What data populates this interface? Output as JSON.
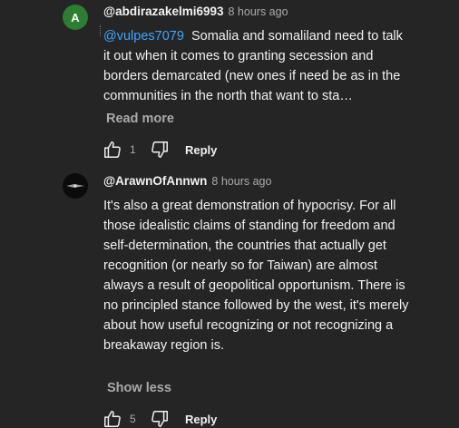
{
  "comments": [
    {
      "avatar_initial": "A",
      "avatar_color": "#2e7d32",
      "author": "@abdirazakelmi6993",
      "time": "8 hours ago",
      "mention": "@vulpes7079",
      "text": "Somalia and somaliland need to talk it out when it comes to granting secession and borders demarcated (new ones if need be as in the communities in the north that want to sta…",
      "toggle_label": "Read more",
      "like_count": "1",
      "reply_label": "Reply"
    },
    {
      "avatar_initial": "",
      "author": "@ArawnOfAnnwn",
      "time": "8 hours ago",
      "text": "It's also a great demonstration of hypocrisy. For all those idealistic claims of standing for freedom and self-determination, the countries that actually get recognition (or nearly so for Taiwan) are almost always a result of geopolitical opportunism. There is no principled stance followed by the west, it's merely about how useful recognizing or not recognizing a breakaway region is.",
      "toggle_label": "Show less",
      "like_count": "5",
      "reply_label": "Reply"
    }
  ],
  "colors": {
    "background": "#252525",
    "text": "#f1f1f1",
    "secondary": "#aaaaaa",
    "mention": "#3ea6ff"
  },
  "icons": [
    "thumb-up-icon",
    "thumb-down-icon"
  ]
}
